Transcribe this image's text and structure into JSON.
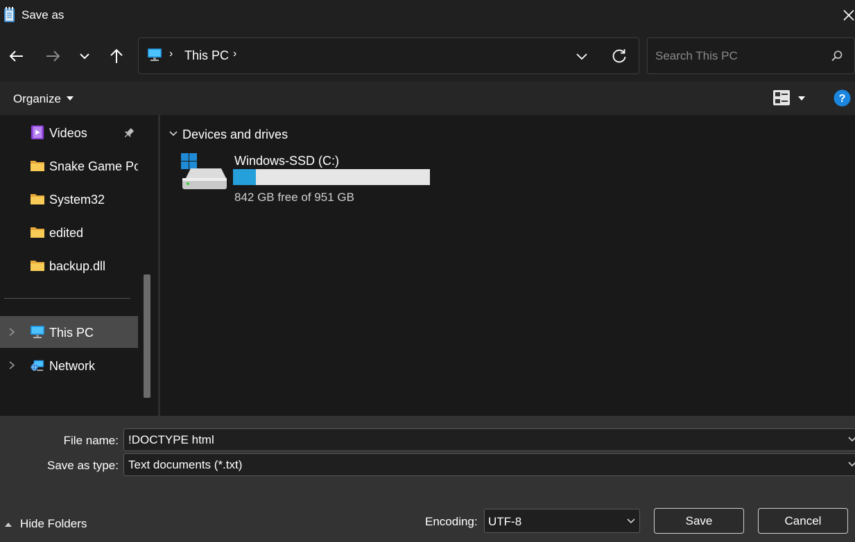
{
  "window": {
    "title": "Save as",
    "close_icon": "close-icon",
    "app_icon": "notepad-icon"
  },
  "nav": {
    "back_icon": "back-arrow-icon",
    "forward_icon": "forward-arrow-icon",
    "recent_icon": "chevron-down-icon",
    "up_icon": "up-arrow-icon",
    "address": {
      "icon": "this-pc-icon",
      "crumb": "This PC",
      "separator": "›"
    },
    "refresh_icon": "refresh-icon",
    "search_placeholder": "Search This PC"
  },
  "toolbar": {
    "organize_label": "Organize",
    "view_icon": "view-options-icon",
    "help_icon": "help-icon"
  },
  "sidebar": {
    "quick_access": [
      {
        "label": "Videos",
        "icon": "videos-icon",
        "pinned": true
      },
      {
        "label": "Snake Game Portfolio",
        "icon": "folder-icon"
      },
      {
        "label": "System32",
        "icon": "folder-icon"
      },
      {
        "label": "edited",
        "icon": "folder-icon"
      },
      {
        "label": "backup.dll",
        "icon": "folder-icon"
      }
    ],
    "tree": [
      {
        "label": "This PC",
        "icon": "this-pc-icon",
        "selected": true
      },
      {
        "label": "Network",
        "icon": "network-icon",
        "selected": false
      }
    ]
  },
  "content": {
    "group_title": "Devices and drives",
    "drives": [
      {
        "name": "Windows-SSD (C:)",
        "free_text": "842 GB free of 951 GB",
        "used_fraction": 0.115,
        "icon": "windows-drive-icon"
      }
    ]
  },
  "form": {
    "file_name_label": "File name:",
    "file_name_value": "!DOCTYPE html",
    "save_type_label": "Save as type:",
    "save_type_value": "Text documents (*.txt)",
    "hide_folders_label": "Hide Folders",
    "encoding_label": "Encoding:",
    "encoding_value": "UTF-8",
    "save_label": "Save",
    "cancel_label": "Cancel"
  },
  "colors": {
    "accent": "#26a0da",
    "background": "#191919",
    "selected": "#4a4a4a",
    "bottom_panel": "#333333"
  }
}
